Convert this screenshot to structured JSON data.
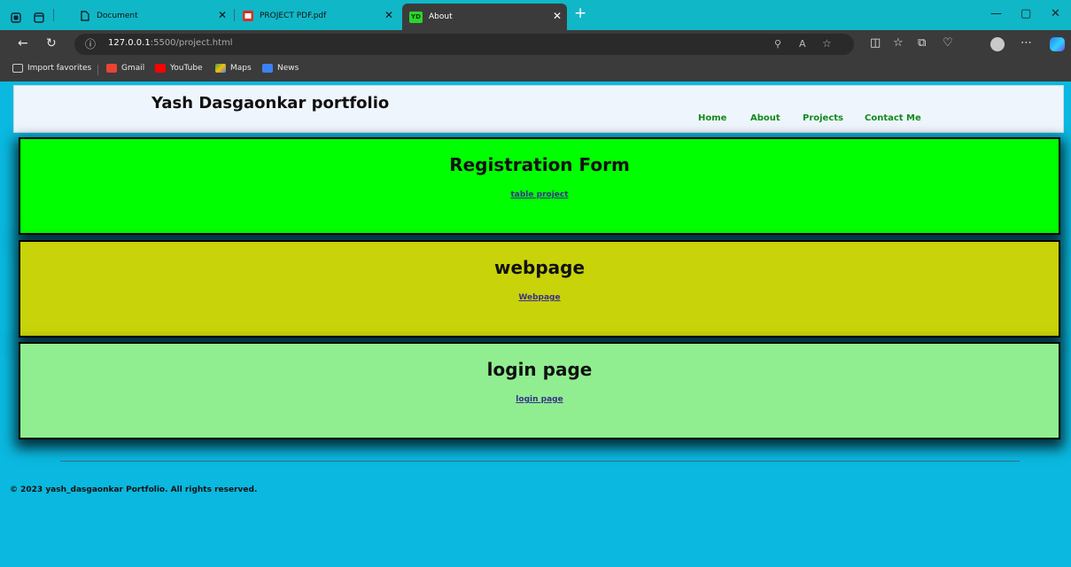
{
  "browser": {
    "tabs": [
      {
        "title": "Document"
      },
      {
        "title": "PROJECT PDF.pdf"
      },
      {
        "title": "About",
        "favicon_text": "YD"
      }
    ],
    "url_host": "127.0.0.1",
    "url_rest": ":5500/project.html",
    "bookmarks": [
      "Import favorites",
      "Gmail",
      "YouTube",
      "Maps",
      "News"
    ]
  },
  "header": {
    "brand": "Yash Dasgaonkar portfolio",
    "nav": [
      "Home",
      "About",
      "Projects",
      "Contact Me"
    ]
  },
  "projects": [
    {
      "title": "Registration Form",
      "link": "table project",
      "color": "#00ff00"
    },
    {
      "title": "webpage",
      "link": "Webpage",
      "color": "#c8d30a"
    },
    {
      "title": "login page",
      "link": "login page",
      "color": "#90ee90"
    }
  ],
  "footer": {
    "text": "© 2023 yash_dasgaonkar Portfolio. All rights reserved."
  },
  "colors": {
    "page_bg": "#0ab8e0",
    "nav_link": "#128a1e",
    "tab_strip": "#10b7c7"
  }
}
